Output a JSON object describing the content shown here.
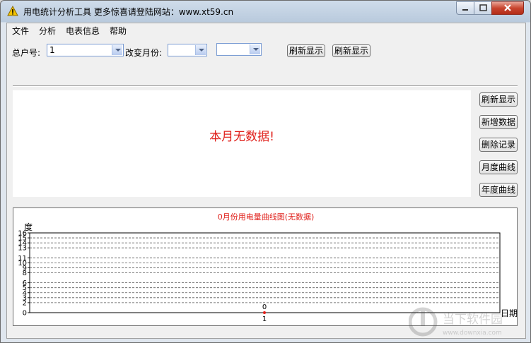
{
  "window": {
    "title": "用电统计分析工具  更多惊喜请登陆网站：www.xt59.cn",
    "icon": "warning-triangle-icon"
  },
  "menu": [
    "文件",
    "分析",
    "电表信息",
    "帮助"
  ],
  "toolbar": {
    "account_label": "总户号:",
    "account_value": "1",
    "change_month_label": "改变月份:",
    "month_value_1": "",
    "month_value_2": "",
    "refresh_1": "刷新显示",
    "refresh_2": "刷新显示"
  },
  "main": {
    "no_data_text": "本月无数据!"
  },
  "side_buttons": [
    "刷新显示",
    "新增数据",
    "删除记录",
    "月度曲线",
    "年度曲线"
  ],
  "chart_data": {
    "type": "line",
    "title": "0月份用电量曲线图(无数据)",
    "ylabel": "度",
    "xlabel": "日期",
    "ylim": [
      0,
      16
    ],
    "yticks": [
      0,
      2,
      3,
      4,
      5,
      6,
      8,
      9,
      10,
      11,
      13,
      14,
      15,
      16
    ],
    "x": [
      1
    ],
    "values": [
      0
    ],
    "data_labels": [
      "0"
    ],
    "grid": true,
    "colors": {
      "title": "#e0201b",
      "point": "#e0201b"
    }
  },
  "watermark": {
    "text": "当下软件园",
    "url": "www.downxia.com"
  }
}
